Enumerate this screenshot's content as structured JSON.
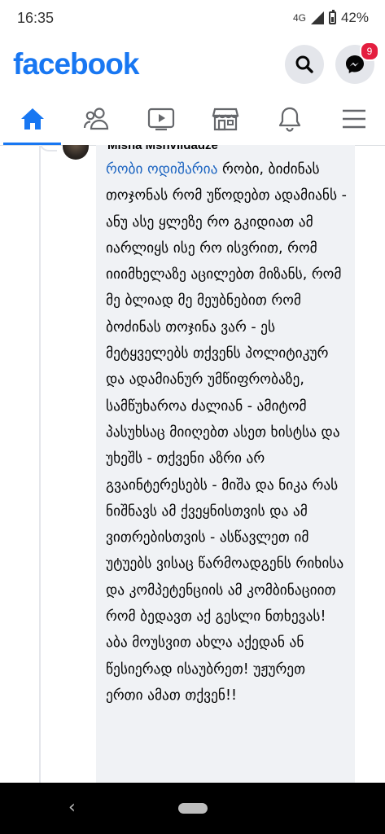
{
  "status_bar": {
    "time": "16:35",
    "network": "4G",
    "battery": "42%"
  },
  "header": {
    "logo": "facebook",
    "messenger_badge": "9"
  },
  "tabs": [
    {
      "name": "home",
      "icon": "home-icon",
      "active": true
    },
    {
      "name": "friends",
      "icon": "friends-icon"
    },
    {
      "name": "watch",
      "icon": "watch-icon"
    },
    {
      "name": "marketplace",
      "icon": "marketplace-icon"
    },
    {
      "name": "notifications",
      "icon": "bell-icon"
    },
    {
      "name": "menu",
      "icon": "menu-icon"
    }
  ],
  "comment": {
    "author": "Misha Mshvildadze",
    "mention": "რობი ოდიშარია",
    "text": " რობი, ბიძინას თოჯონას რომ უწოდებთ ადამიანს - ანუ ასე ყლეზე რო გკიდიათ ამ იარლიყს ისე რო ისვრით, რომ იიიმხელაზე აცილებთ მიზანს, რომ მე ბლიად მე მეუბნებით რომ ბოძინას თოჯინა ვარ - ეს მეტყველებს თქვენს პოლიტიკურ და ადამიანურ უმწიფრობაზე, სამწუხაროა ძალიან - ამიტომ პასუხსაც მიიღებთ ასეთ ხისტსა და უხეშს - თქვენი აზრი არ გვაინტერესებს - მიშა და ნიკა რას ნიშნავს ამ ქვეყნისთვის და ამ ვითრებისთვის - ასწავლეთ იმ უტუებს ვისაც წარმოადგენს რიხისა და კომპეტენციის ამ კომბინაციით რომ ბედავთ აქ გესლი ნთხევას! აბა მოუსვით ახლა აქედან ან წესიერად ისაუბრეთ! უჟურეთ ერთი ამათ თქვენ!!"
  },
  "colors": {
    "brand": "#1877f2",
    "badge": "#e41e3f",
    "mention": "#1d65c1",
    "bubble": "#f0f2f5"
  }
}
